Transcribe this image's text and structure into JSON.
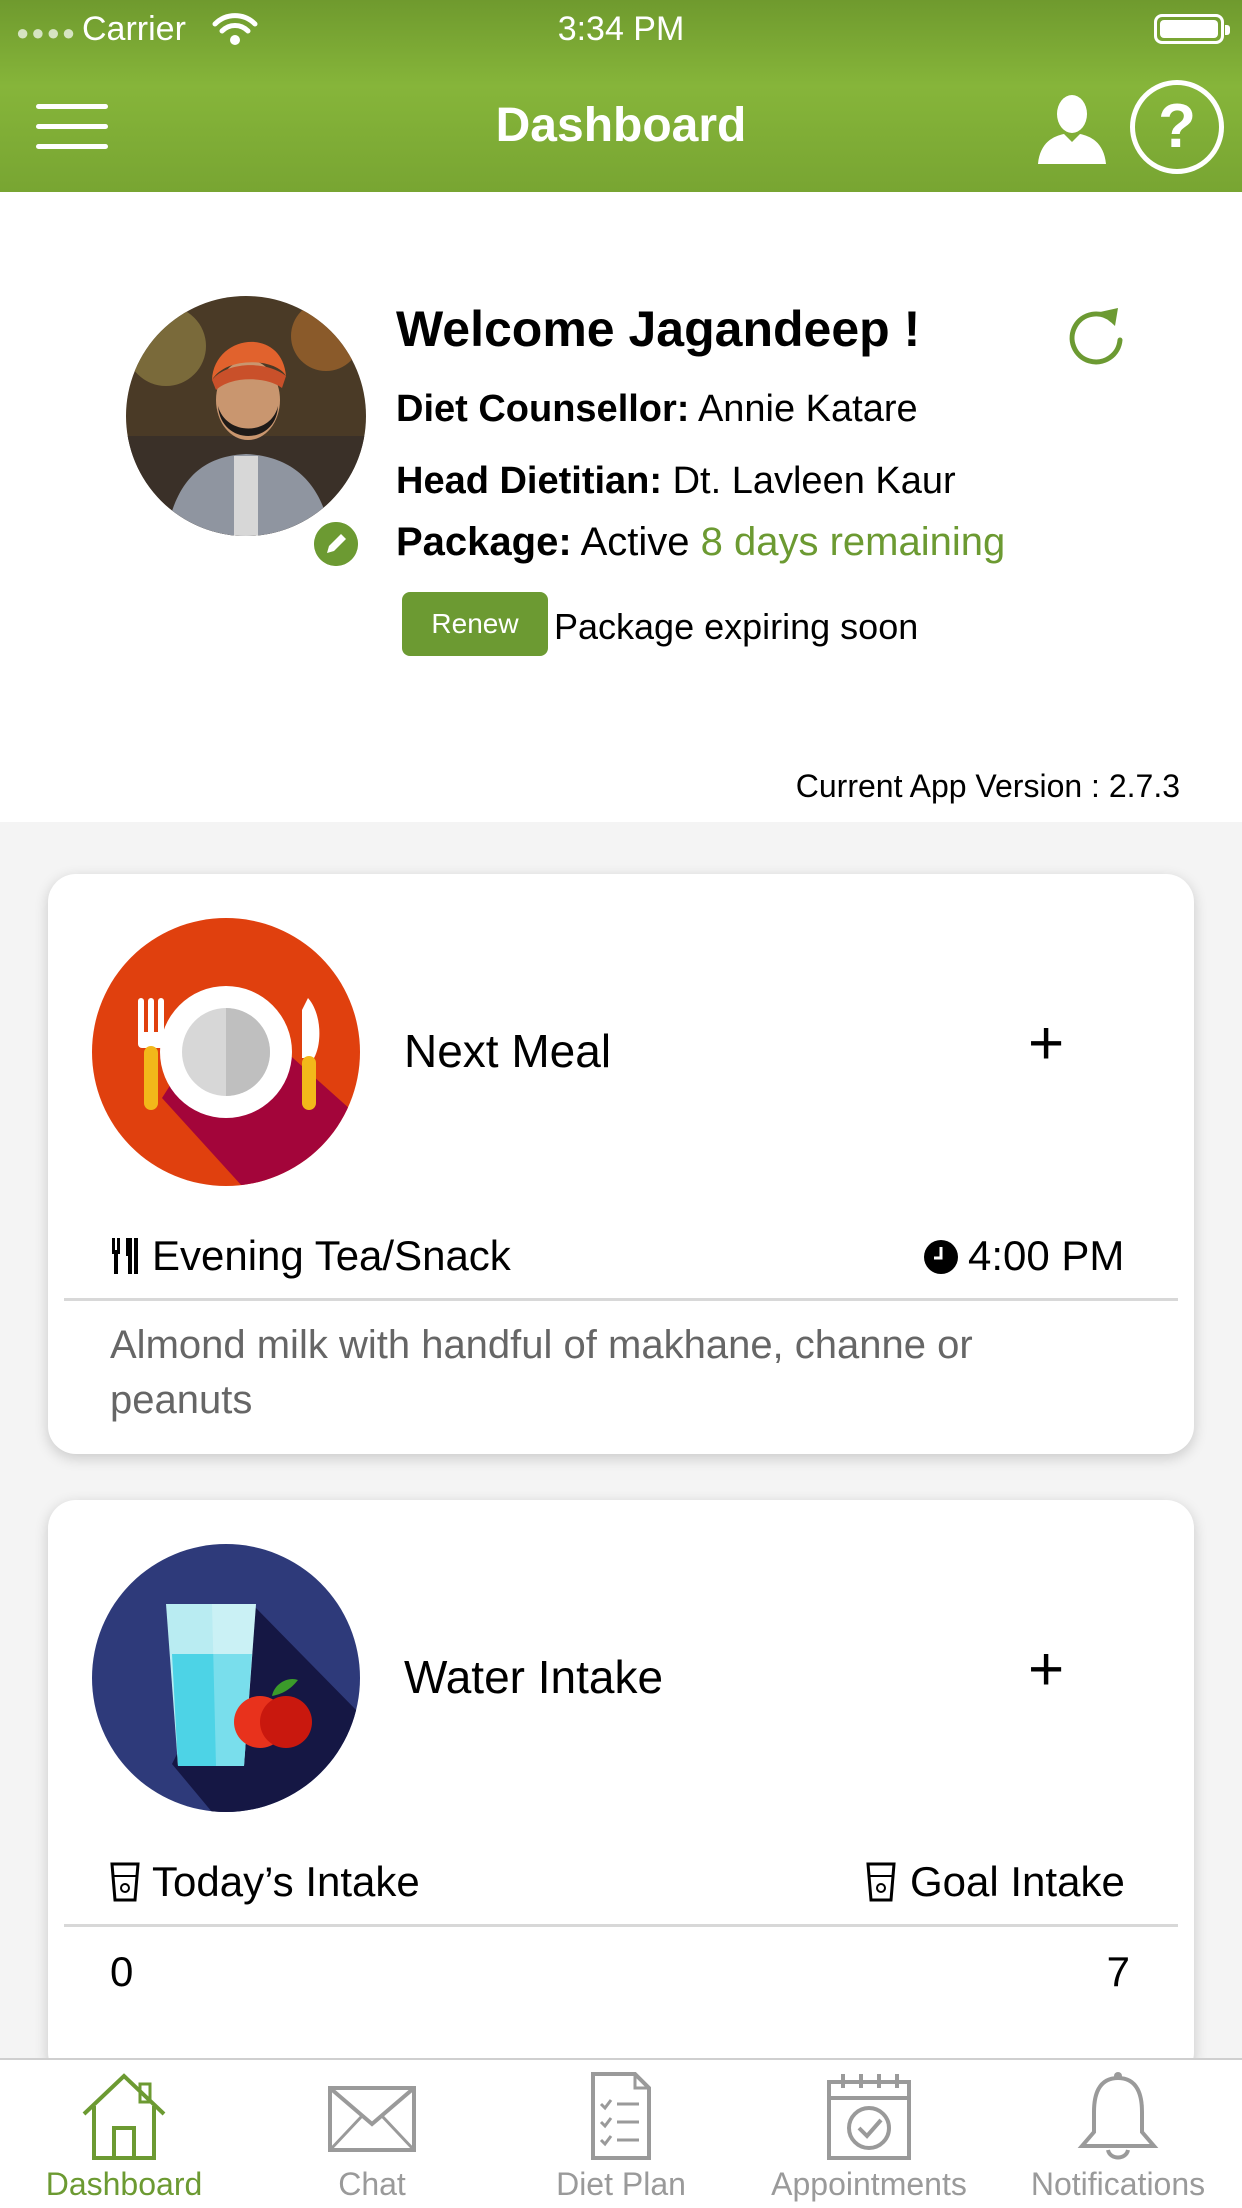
{
  "status_bar": {
    "carrier": "Carrier",
    "time": "3:34 PM"
  },
  "header": {
    "title": "Dashboard"
  },
  "profile": {
    "welcome": "Welcome Jagandeep !",
    "counsellor_label": "Diet Counsellor:",
    "counsellor_name": "Annie Katare",
    "dietitian_label": "Head Dietitian:",
    "dietitian_name": "Dt. Lavleen Kaur",
    "package_label": "Package:",
    "package_status": "Active",
    "package_remaining": "8 days remaining",
    "renew_label": "Renew",
    "expiring_text": "Package expiring soon",
    "app_version": "Current App Version : 2.7.3"
  },
  "next_meal": {
    "title": "Next Meal",
    "plus": "+",
    "meal_name": "Evening Tea/Snack",
    "meal_time": "4:00 PM",
    "description": "Almond milk with handful of makhane, channe or peanuts"
  },
  "water_intake": {
    "title": "Water Intake",
    "plus": "+",
    "today_label": "Today’s Intake",
    "goal_label": "Goal Intake",
    "today_value": "0",
    "goal_value": "7"
  },
  "tabs": [
    {
      "label": "Dashboard",
      "icon": "home-icon",
      "active": true
    },
    {
      "label": "Chat",
      "icon": "mail-icon",
      "active": false
    },
    {
      "label": "Diet Plan",
      "icon": "checklist-icon",
      "active": false
    },
    {
      "label": "Appointments",
      "icon": "calendar-check-icon",
      "active": false
    },
    {
      "label": "Notifications",
      "icon": "bell-icon",
      "active": false
    }
  ],
  "colors": {
    "brand_green": "#6c9a32",
    "header_green": "#86b53a",
    "meal_icon_bg": "#e0400e",
    "water_icon_bg": "#2e3a7a"
  }
}
